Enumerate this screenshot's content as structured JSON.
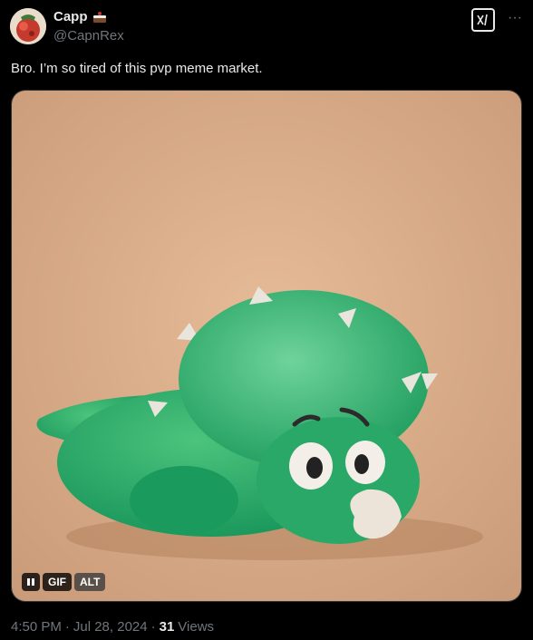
{
  "author": {
    "display_name": "Capp",
    "handle": "@CapnRex",
    "avatar_icon": "avatar-image",
    "name_emoji_icon": "cake-emoji-icon"
  },
  "header": {
    "grok_icon": "grok-icon",
    "more_icon": "more-options-icon",
    "more_label": "···"
  },
  "tweet": {
    "text": "Bro. I’m so tired of this pvp meme market."
  },
  "media": {
    "type": "GIF",
    "gif_label": "GIF",
    "alt_label": "ALT",
    "pause_icon": "pause-icon",
    "background_color": "#dcaf8c"
  },
  "meta": {
    "time": "4:50 PM",
    "separator": "·",
    "date": "Jul 28, 2024",
    "views_count": "31",
    "views_label": "Views"
  }
}
